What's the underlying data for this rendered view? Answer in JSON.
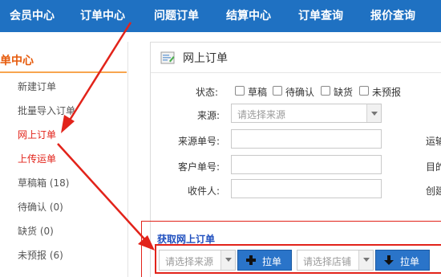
{
  "nav": {
    "items": [
      "会员中心",
      "订单中心",
      "问题订单",
      "结算中心",
      "订单查询",
      "报价查询"
    ]
  },
  "sidebar": {
    "header": "单中心",
    "items": [
      {
        "label": "新建订单"
      },
      {
        "label": "批量导入订单"
      },
      {
        "label": "网上订单"
      },
      {
        "label": "上传运单"
      },
      {
        "label": "草稿箱 (18)"
      },
      {
        "label": "待确认 (0)"
      },
      {
        "label": "缺货 (0)"
      },
      {
        "label": "未预报 (6)"
      }
    ]
  },
  "panel": {
    "title": "网上订单",
    "status_label": "状态:",
    "status_options": [
      "草稿",
      "待确认",
      "缺货",
      "未预报"
    ],
    "source_label": "来源:",
    "source_placeholder": "请选择来源",
    "source_no_label": "来源单号:",
    "customer_no_label": "客户单号:",
    "receiver_label": "收件人:",
    "right_labels": [
      "运输",
      "目的",
      "创建"
    ]
  },
  "fetch": {
    "title": "获取网上订单",
    "source_placeholder": "请选择来源",
    "pull_label_1": "拉单",
    "store_placeholder": "请选择店铺",
    "pull_label_2": "拉单"
  },
  "colors": {
    "nav_bg": "#1f71c2",
    "accent_orange": "#e65a0b",
    "annotation_red": "#e2231a",
    "button_blue": "#2a74c9"
  }
}
